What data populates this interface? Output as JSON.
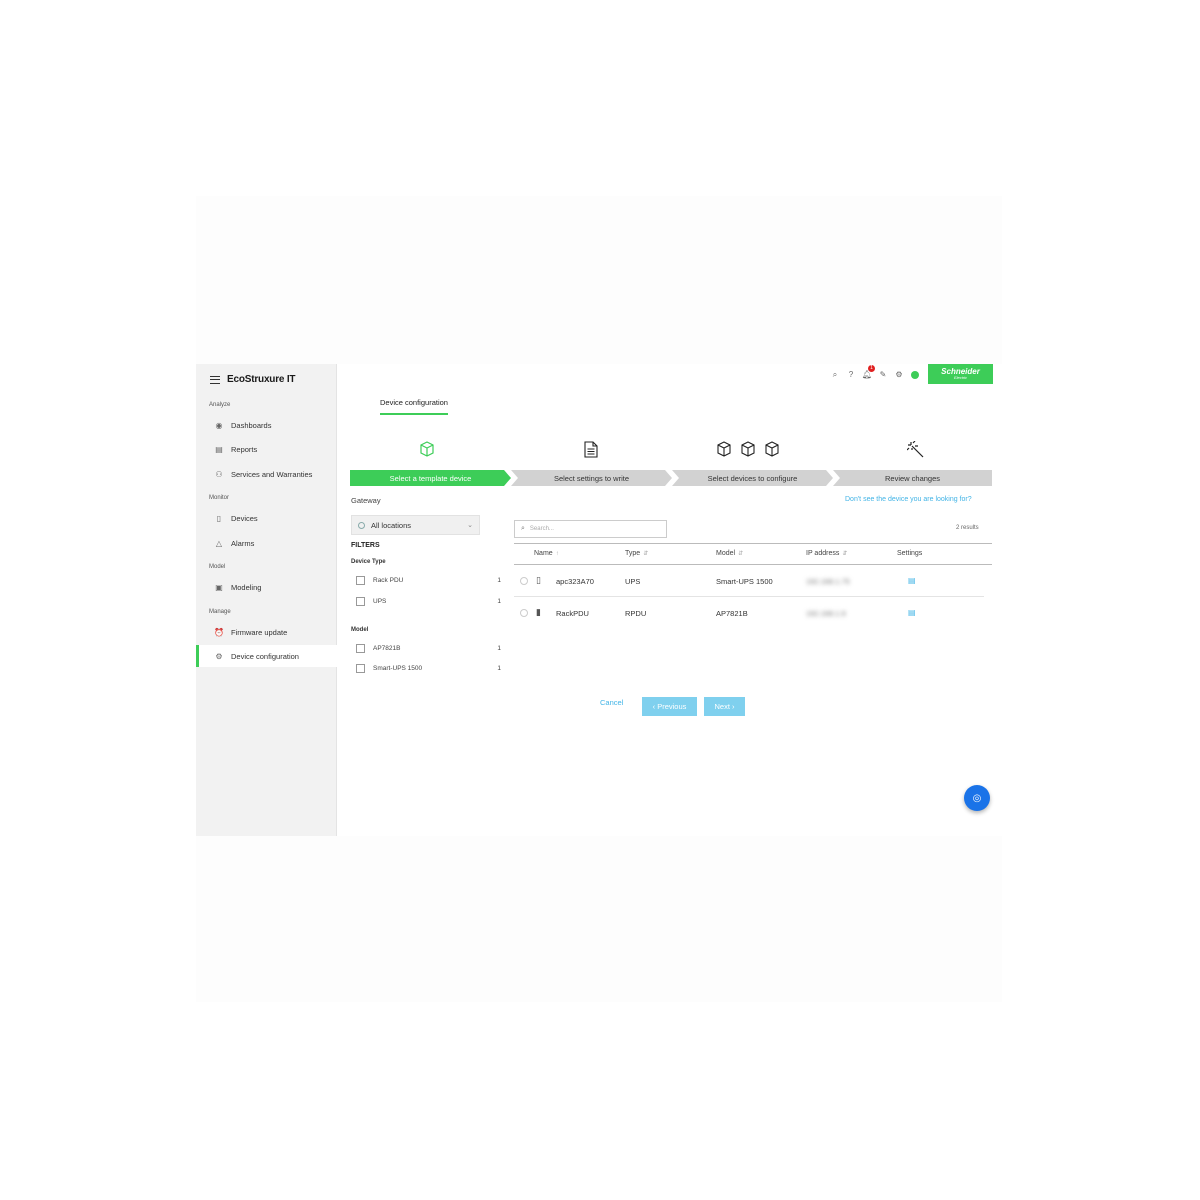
{
  "brand": {
    "name": "EcoStruxure IT"
  },
  "sidebar": {
    "sections": [
      {
        "label": "Analyze",
        "items": [
          {
            "label": "Dashboards",
            "icon": "eye-icon"
          },
          {
            "label": "Reports",
            "icon": "report-icon"
          },
          {
            "label": "Services and Warranties",
            "icon": "services-icon"
          }
        ]
      },
      {
        "label": "Monitor",
        "items": [
          {
            "label": "Devices",
            "icon": "device-icon"
          },
          {
            "label": "Alarms",
            "icon": "warning-icon"
          }
        ]
      },
      {
        "label": "Model",
        "items": [
          {
            "label": "Modeling",
            "icon": "modeling-icon"
          }
        ]
      },
      {
        "label": "Manage",
        "items": [
          {
            "label": "Firmware update",
            "icon": "firmware-icon"
          },
          {
            "label": "Device configuration",
            "icon": "config-icon",
            "active": true
          }
        ]
      }
    ]
  },
  "header": {
    "notification_count": "1",
    "logo_text": "Schneider",
    "logo_sub": "Electric"
  },
  "page": {
    "tab": "Device configuration"
  },
  "steps": [
    {
      "label": "Select a template device",
      "active": true
    },
    {
      "label": "Select settings to write",
      "active": false
    },
    {
      "label": "Select devices to configure",
      "active": false
    },
    {
      "label": "Review changes",
      "active": false
    }
  ],
  "filters": {
    "gateway_label": "Gateway",
    "location_value": "All locations",
    "title": "FILTERS",
    "device_type_title": "Device Type",
    "device_types": [
      {
        "label": "Rack PDU",
        "count": "1"
      },
      {
        "label": "UPS",
        "count": "1"
      }
    ],
    "model_title": "Model",
    "models": [
      {
        "label": "AP7821B",
        "count": "1"
      },
      {
        "label": "Smart-UPS 1500",
        "count": "1"
      }
    ]
  },
  "help_link": "Don't see the device you are looking for?",
  "search": {
    "placeholder": "Search..."
  },
  "results": "2 results",
  "table": {
    "headers": {
      "name": "Name",
      "type": "Type",
      "model": "Model",
      "ip": "IP address",
      "settings": "Settings"
    },
    "rows": [
      {
        "name": "apc323A70",
        "type": "UPS",
        "model": "Smart-UPS 1500",
        "ip": "192.168.1.75"
      },
      {
        "name": "RackPDU",
        "type": "RPDU",
        "model": "AP7821B",
        "ip": "192.168.1.9"
      }
    ]
  },
  "actions": {
    "cancel": "Cancel",
    "previous": "Previous",
    "next": "Next"
  },
  "colors": {
    "accent": "#3dcd58",
    "link": "#42b4e6",
    "fab": "#1a73e8"
  }
}
